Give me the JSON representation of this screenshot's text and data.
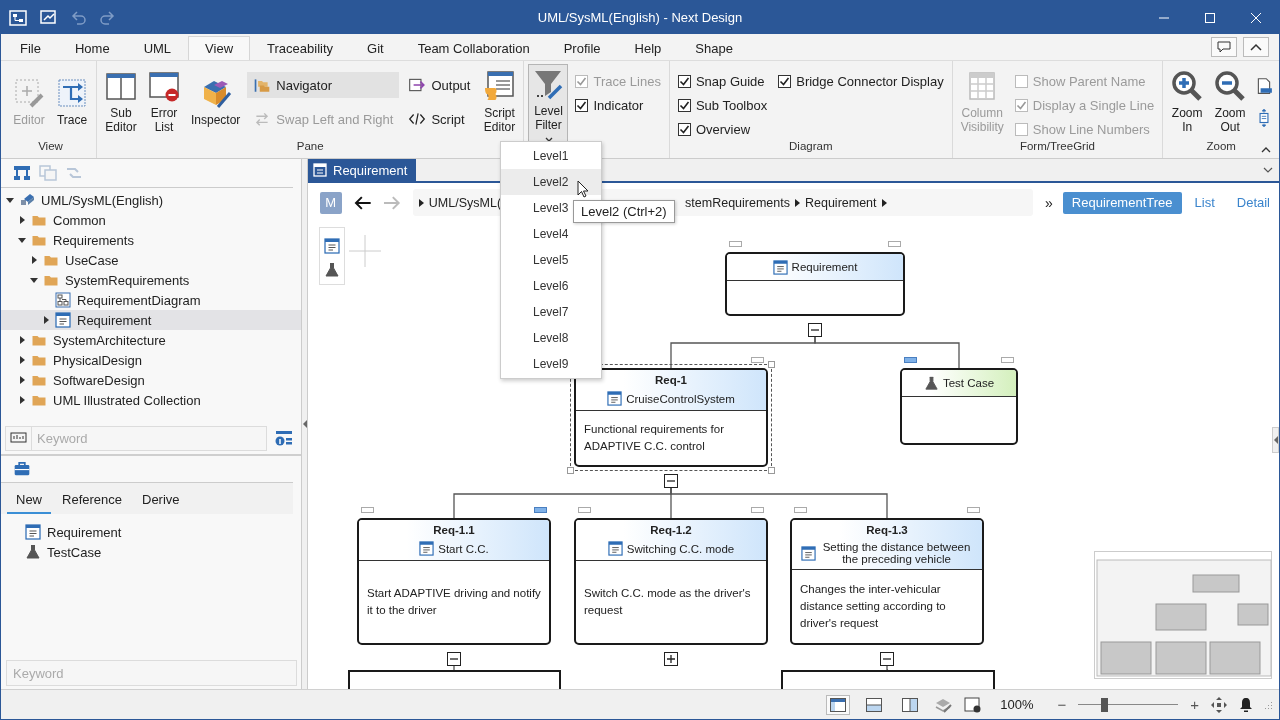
{
  "window": {
    "title": "UML/SysML(English) - Next Design"
  },
  "menu": [
    {
      "label": "File",
      "selected": false
    },
    {
      "label": "Home",
      "selected": false
    },
    {
      "label": "UML",
      "selected": false
    },
    {
      "label": "View",
      "selected": true
    },
    {
      "label": "Traceability",
      "selected": false
    },
    {
      "label": "Git",
      "selected": false
    },
    {
      "label": "Team Collaboration",
      "selected": false
    },
    {
      "label": "Profile",
      "selected": false
    },
    {
      "label": "Help",
      "selected": false
    },
    {
      "label": "Shape",
      "selected": false
    }
  ],
  "ribbon": {
    "groups": [
      {
        "label": "View",
        "items": [
          {
            "kind": "large",
            "label": "Editor",
            "disabled": true
          },
          {
            "kind": "large",
            "label": "Trace",
            "disabled": false
          }
        ]
      },
      {
        "label": "Pane",
        "items": [
          {
            "kind": "large",
            "label": "Sub Editor",
            "disabled": false
          },
          {
            "kind": "large",
            "label": "Error List",
            "disabled": false
          },
          {
            "kind": "large",
            "label": "Inspector",
            "disabled": false
          },
          {
            "kind": "small",
            "label": "Navigator",
            "disabled": false,
            "selected": true
          },
          {
            "kind": "small",
            "label": "Swap Left and Right",
            "disabled": true,
            "selected": false
          },
          {
            "kind": "small",
            "label": "Output",
            "disabled": false,
            "selected": false
          },
          {
            "kind": "small",
            "label": "Script",
            "disabled": false,
            "selected": false
          },
          {
            "kind": "large",
            "label": "Script Editor",
            "disabled": false
          }
        ]
      },
      {
        "items": [
          {
            "kind": "dropdown",
            "label": "Level Filter",
            "disabled": false,
            "open": true
          },
          {
            "kind": "check",
            "label": "Trace Lines",
            "disabled": true,
            "checked": true
          },
          {
            "kind": "check",
            "label": "Indicator",
            "disabled": false,
            "checked": true
          }
        ]
      },
      {
        "label": "Diagram",
        "items": [
          {
            "kind": "check",
            "label": "Snap Guide",
            "disabled": false,
            "checked": true
          },
          {
            "kind": "check",
            "label": "Sub Toolbox",
            "disabled": false,
            "checked": true
          },
          {
            "kind": "check",
            "label": "Overview",
            "disabled": false,
            "checked": true
          },
          {
            "kind": "check",
            "label": "Bridge Connector Display",
            "disabled": false,
            "checked": true
          }
        ]
      },
      {
        "label": "Form/TreeGrid",
        "items": [
          {
            "kind": "large",
            "label": "Column Visibility",
            "disabled": true
          },
          {
            "kind": "check",
            "label": "Show Parent Name",
            "disabled": true,
            "checked": false
          },
          {
            "kind": "check",
            "label": "Display a Single Line",
            "disabled": true,
            "checked": true
          },
          {
            "kind": "check",
            "label": "Show Line Numbers",
            "disabled": true,
            "checked": false
          }
        ]
      },
      {
        "label": "Zoom",
        "items": [
          {
            "kind": "large",
            "label": "Zoom In",
            "disabled": false
          },
          {
            "kind": "large",
            "label": "Zoom Out",
            "disabled": false
          },
          {
            "kind": "icon",
            "disabled": false
          },
          {
            "kind": "icon",
            "disabled": false
          }
        ]
      }
    ]
  },
  "navigator": {
    "toolbar": [
      {
        "disabled": false
      },
      {
        "disabled": true
      },
      {
        "disabled": true
      }
    ],
    "tree": [
      {
        "label": "UML/SysML(English)",
        "kind": "model",
        "expanded": true,
        "selected": false,
        "children": [
          {
            "label": "Common",
            "kind": "folder",
            "expanded": false,
            "selected": false
          },
          {
            "label": "Requirements",
            "kind": "folder",
            "expanded": true,
            "selected": false,
            "children": [
              {
                "label": "UseCase",
                "kind": "folder",
                "expanded": false,
                "selected": false
              },
              {
                "label": "SystemRequirements",
                "kind": "folder",
                "expanded": true,
                "selected": false,
                "children": [
                  {
                    "label": "RequirementDiagram",
                    "kind": "diagram",
                    "selected": false
                  },
                  {
                    "label": "Requirement",
                    "kind": "requirement",
                    "expanded": false,
                    "selected": true
                  }
                ]
              }
            ]
          },
          {
            "label": "SystemArchitecture",
            "kind": "folder",
            "expanded": false,
            "selected": false
          },
          {
            "label": "PhysicalDesign",
            "kind": "folder",
            "expanded": false,
            "selected": false
          },
          {
            "label": "SoftwareDesign",
            "kind": "folder",
            "expanded": false,
            "selected": false
          },
          {
            "label": "UML Illustrated Collection",
            "kind": "folder",
            "expanded": false,
            "selected": false
          }
        ]
      }
    ],
    "search": {
      "placeholder": "Keyword"
    }
  },
  "toolbox": {
    "tabs": [
      {
        "label": "New",
        "selected": true
      },
      {
        "label": "Reference",
        "selected": false
      },
      {
        "label": "Derive",
        "selected": false
      }
    ],
    "items": [
      {
        "kind": "requirement",
        "label": "Requirement"
      },
      {
        "kind": "testcase",
        "label": "TestCase"
      }
    ],
    "search": {
      "placeholder": "Keyword"
    }
  },
  "editor": {
    "tabs": [
      {
        "label": "Requirement",
        "selected": true
      }
    ],
    "mode_button": "M",
    "breadcrumb": [
      {
        "label": "UML/SysML("
      },
      {
        "label": "stemRequirements"
      },
      {
        "label": "Requirement"
      }
    ],
    "overflow": "»",
    "views": [
      {
        "label": "RequirementTree",
        "selected": true
      },
      {
        "label": "List",
        "selected": false
      },
      {
        "label": "Detail",
        "selected": false
      }
    ],
    "diagram": {
      "nodes": [
        {
          "kind": "requirement",
          "name": "Requirement",
          "selected": false,
          "expanded": true,
          "left_indicator": {
            "filled": false
          },
          "right_indicator": {
            "filled": false
          },
          "children": [
            {
              "kind": "requirement",
              "id": "Req-1",
              "name": "CruiseControlSystem",
              "text": "Functional requirements for ADAPTIVE C.C. control",
              "selected": true,
              "expanded": true,
              "right_indicator": {
                "filled": false
              },
              "children": [
                {
                  "kind": "requirement",
                  "id": "Req-1.1",
                  "name": "Start C.C.",
                  "text": "Start ADAPTIVE driving and notify it to the driver",
                  "selected": false,
                  "expanded": true,
                  "left_indicator": {
                    "filled": false
                  },
                  "right_indicator": {
                    "filled": true
                  },
                  "children": [
                    {
                      "kind": "offscreen",
                      "selected": false
                    }
                  ]
                },
                {
                  "kind": "requirement",
                  "id": "Req-1.2",
                  "name": "Switching C.C. mode",
                  "text": "Switch C.C. mode as the driver's request",
                  "selected": false,
                  "expanded": false,
                  "left_indicator": {
                    "filled": false
                  },
                  "right_indicator": {
                    "filled": false
                  }
                },
                {
                  "kind": "requirement",
                  "id": "Req-1.3",
                  "name": "Setting the distance between the preceding vehicle",
                  "text": "Changes the inter-vehicular distance setting according to driver's request",
                  "selected": false,
                  "expanded": true,
                  "left_indicator": {
                    "filled": false
                  },
                  "right_indicator": {
                    "filled": false
                  },
                  "children": [
                    {
                      "kind": "offscreen",
                      "selected": false
                    }
                  ]
                }
              ]
            },
            {
              "kind": "testcase",
              "name": "Test Case",
              "selected": false,
              "left_indicator": {
                "filled": true
              },
              "right_indicator": {
                "filled": false
              }
            }
          ]
        }
      ]
    },
    "level_menu": {
      "items": [
        {
          "label": "Level1",
          "highlighted": false
        },
        {
          "label": "Level2",
          "highlighted": true
        },
        {
          "label": "Level3",
          "highlighted": false
        },
        {
          "label": "Level4",
          "highlighted": false
        },
        {
          "label": "Level5",
          "highlighted": false
        },
        {
          "label": "Level6",
          "highlighted": false
        },
        {
          "label": "Level7",
          "highlighted": false
        },
        {
          "label": "Level8",
          "highlighted": false
        },
        {
          "label": "Level9",
          "highlighted": false
        }
      ],
      "tooltip": "Level2 (Ctrl+2)"
    }
  },
  "status_bar": {
    "view_buttons": [
      {
        "selected": true
      },
      {
        "selected": false
      },
      {
        "selected": false
      }
    ],
    "zoom": "100%",
    "zoom_out": "−",
    "zoom_in": "+",
    "zoom_slider": {
      "level": 0.26
    }
  }
}
